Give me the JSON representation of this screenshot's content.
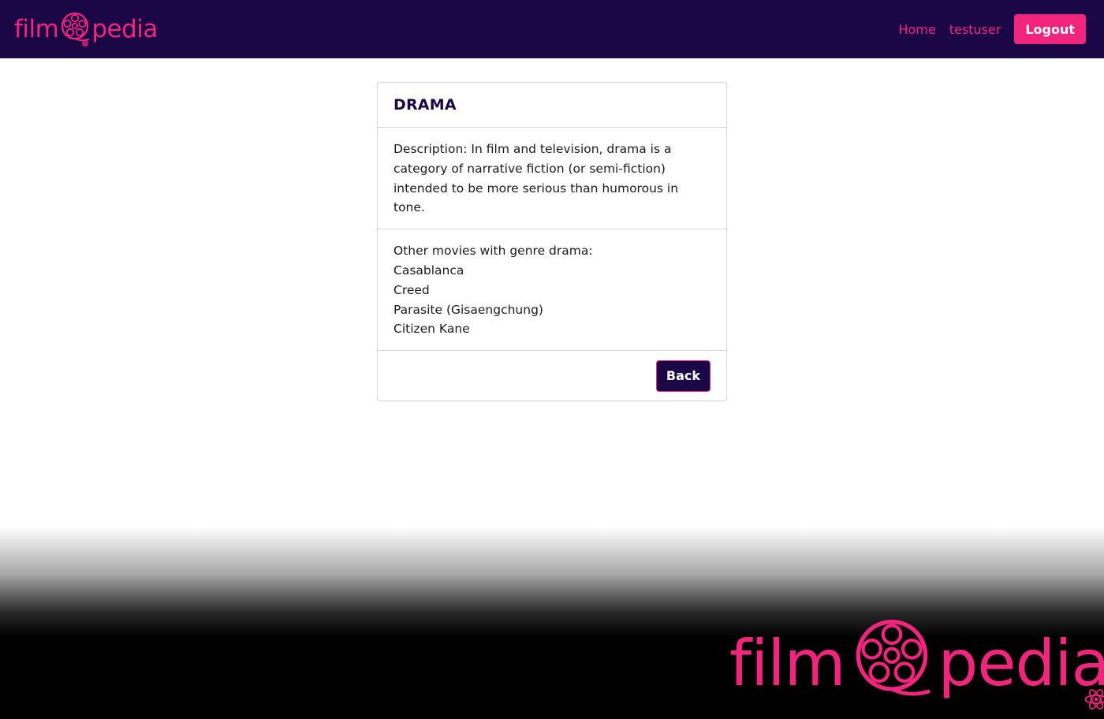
{
  "nav": {
    "brand_left": "film",
    "brand_right": "pedia",
    "links": [
      {
        "label": "Home"
      },
      {
        "label": "testuser"
      }
    ],
    "logout_label": "Logout"
  },
  "genre": {
    "title": "DRAMA",
    "description": "Description: In film and television, drama is a category of narrative fiction (or semi-fiction) intended to be more serious than humorous in tone.",
    "other_heading": "Other movies with genre drama:",
    "movies": [
      "Casablanca",
      "Creed",
      "Parasite (Gisaengchung)",
      "Citizen Kane"
    ],
    "back_label": "Back"
  },
  "footer_logo": {
    "left": "film",
    "right": "pedia"
  },
  "colors": {
    "brand_pink": "#f2257e",
    "nav_bg": "#1c0746"
  },
  "icons": [
    "film-reel-icon",
    "react-atom-icon"
  ]
}
